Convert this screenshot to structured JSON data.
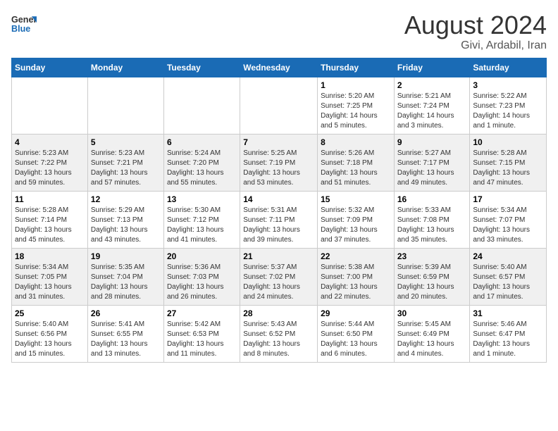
{
  "header": {
    "logo_line1": "General",
    "logo_line2": "Blue",
    "title": "August 2024",
    "subtitle": "Givi, Ardabil, Iran"
  },
  "calendar": {
    "days_of_week": [
      "Sunday",
      "Monday",
      "Tuesday",
      "Wednesday",
      "Thursday",
      "Friday",
      "Saturday"
    ],
    "weeks": [
      [
        {
          "day": "",
          "info": ""
        },
        {
          "day": "",
          "info": ""
        },
        {
          "day": "",
          "info": ""
        },
        {
          "day": "",
          "info": ""
        },
        {
          "day": "1",
          "info": "Sunrise: 5:20 AM\nSunset: 7:25 PM\nDaylight: 14 hours\nand 5 minutes."
        },
        {
          "day": "2",
          "info": "Sunrise: 5:21 AM\nSunset: 7:24 PM\nDaylight: 14 hours\nand 3 minutes."
        },
        {
          "day": "3",
          "info": "Sunrise: 5:22 AM\nSunset: 7:23 PM\nDaylight: 14 hours\nand 1 minute."
        }
      ],
      [
        {
          "day": "4",
          "info": "Sunrise: 5:23 AM\nSunset: 7:22 PM\nDaylight: 13 hours\nand 59 minutes."
        },
        {
          "day": "5",
          "info": "Sunrise: 5:23 AM\nSunset: 7:21 PM\nDaylight: 13 hours\nand 57 minutes."
        },
        {
          "day": "6",
          "info": "Sunrise: 5:24 AM\nSunset: 7:20 PM\nDaylight: 13 hours\nand 55 minutes."
        },
        {
          "day": "7",
          "info": "Sunrise: 5:25 AM\nSunset: 7:19 PM\nDaylight: 13 hours\nand 53 minutes."
        },
        {
          "day": "8",
          "info": "Sunrise: 5:26 AM\nSunset: 7:18 PM\nDaylight: 13 hours\nand 51 minutes."
        },
        {
          "day": "9",
          "info": "Sunrise: 5:27 AM\nSunset: 7:17 PM\nDaylight: 13 hours\nand 49 minutes."
        },
        {
          "day": "10",
          "info": "Sunrise: 5:28 AM\nSunset: 7:15 PM\nDaylight: 13 hours\nand 47 minutes."
        }
      ],
      [
        {
          "day": "11",
          "info": "Sunrise: 5:28 AM\nSunset: 7:14 PM\nDaylight: 13 hours\nand 45 minutes."
        },
        {
          "day": "12",
          "info": "Sunrise: 5:29 AM\nSunset: 7:13 PM\nDaylight: 13 hours\nand 43 minutes."
        },
        {
          "day": "13",
          "info": "Sunrise: 5:30 AM\nSunset: 7:12 PM\nDaylight: 13 hours\nand 41 minutes."
        },
        {
          "day": "14",
          "info": "Sunrise: 5:31 AM\nSunset: 7:11 PM\nDaylight: 13 hours\nand 39 minutes."
        },
        {
          "day": "15",
          "info": "Sunrise: 5:32 AM\nSunset: 7:09 PM\nDaylight: 13 hours\nand 37 minutes."
        },
        {
          "day": "16",
          "info": "Sunrise: 5:33 AM\nSunset: 7:08 PM\nDaylight: 13 hours\nand 35 minutes."
        },
        {
          "day": "17",
          "info": "Sunrise: 5:34 AM\nSunset: 7:07 PM\nDaylight: 13 hours\nand 33 minutes."
        }
      ],
      [
        {
          "day": "18",
          "info": "Sunrise: 5:34 AM\nSunset: 7:05 PM\nDaylight: 13 hours\nand 31 minutes."
        },
        {
          "day": "19",
          "info": "Sunrise: 5:35 AM\nSunset: 7:04 PM\nDaylight: 13 hours\nand 28 minutes."
        },
        {
          "day": "20",
          "info": "Sunrise: 5:36 AM\nSunset: 7:03 PM\nDaylight: 13 hours\nand 26 minutes."
        },
        {
          "day": "21",
          "info": "Sunrise: 5:37 AM\nSunset: 7:02 PM\nDaylight: 13 hours\nand 24 minutes."
        },
        {
          "day": "22",
          "info": "Sunrise: 5:38 AM\nSunset: 7:00 PM\nDaylight: 13 hours\nand 22 minutes."
        },
        {
          "day": "23",
          "info": "Sunrise: 5:39 AM\nSunset: 6:59 PM\nDaylight: 13 hours\nand 20 minutes."
        },
        {
          "day": "24",
          "info": "Sunrise: 5:40 AM\nSunset: 6:57 PM\nDaylight: 13 hours\nand 17 minutes."
        }
      ],
      [
        {
          "day": "25",
          "info": "Sunrise: 5:40 AM\nSunset: 6:56 PM\nDaylight: 13 hours\nand 15 minutes."
        },
        {
          "day": "26",
          "info": "Sunrise: 5:41 AM\nSunset: 6:55 PM\nDaylight: 13 hours\nand 13 minutes."
        },
        {
          "day": "27",
          "info": "Sunrise: 5:42 AM\nSunset: 6:53 PM\nDaylight: 13 hours\nand 11 minutes."
        },
        {
          "day": "28",
          "info": "Sunrise: 5:43 AM\nSunset: 6:52 PM\nDaylight: 13 hours\nand 8 minutes."
        },
        {
          "day": "29",
          "info": "Sunrise: 5:44 AM\nSunset: 6:50 PM\nDaylight: 13 hours\nand 6 minutes."
        },
        {
          "day": "30",
          "info": "Sunrise: 5:45 AM\nSunset: 6:49 PM\nDaylight: 13 hours\nand 4 minutes."
        },
        {
          "day": "31",
          "info": "Sunrise: 5:46 AM\nSunset: 6:47 PM\nDaylight: 13 hours\nand 1 minute."
        }
      ]
    ]
  }
}
